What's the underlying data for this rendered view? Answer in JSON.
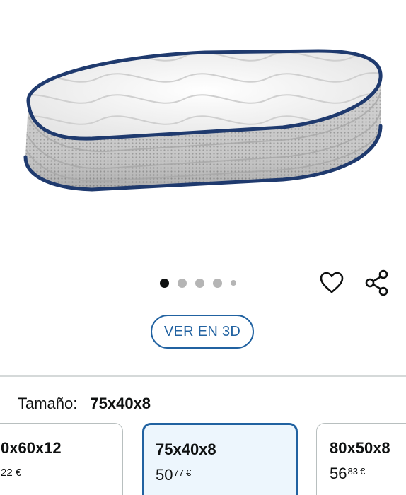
{
  "carousel": {
    "count": 5,
    "active_index": 0
  },
  "actions": {
    "wishlist_icon": "heart-icon",
    "share_icon": "share-icon"
  },
  "view3d": {
    "label": "VER EN 3D"
  },
  "size": {
    "label": "Tamaño:",
    "value": "75x40x8"
  },
  "variants": [
    {
      "name": "0x60x12",
      "price_cents": "22",
      "currency": "€"
    },
    {
      "name": "75x40x8",
      "price_main": "50",
      "price_cents": "77",
      "currency": "€",
      "selected": true
    },
    {
      "name": "80x50x8",
      "price_main": "56",
      "price_cents": "83",
      "currency": "€"
    }
  ],
  "colors": {
    "accent": "#2162a1",
    "selected_bg": "#edf6fd",
    "piping": "#1f3a6e"
  }
}
